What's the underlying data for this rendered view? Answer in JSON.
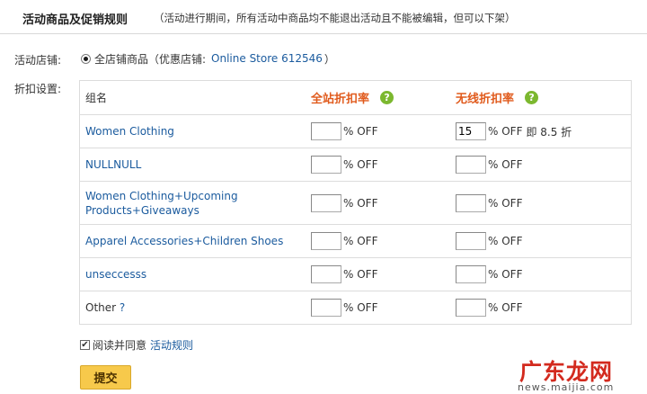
{
  "header": {
    "title": "活动商品及促销规则",
    "note": "（活动进行期间，所有活动中商品均不能退出活动且不能被编辑，但可以下架）"
  },
  "store": {
    "label": "活动店铺:",
    "option_text": "全店铺商品（优惠店铺:",
    "store_name": "Online Store 612546",
    "suffix": "）"
  },
  "discount": {
    "label": "折扣设置:",
    "columns": {
      "group": "组名",
      "site_rate": "全站折扣率",
      "mobile_rate": "无线折扣率",
      "help_glyph": "?"
    },
    "off_text": "% OFF",
    "rows": [
      {
        "name": "Women Clothing",
        "site_value": "",
        "mobile_value": "15",
        "mobile_extra": "即 8.5 折"
      },
      {
        "name": "NULLNULL",
        "site_value": "",
        "mobile_value": "",
        "mobile_extra": ""
      },
      {
        "name": "Women Clothing+Upcoming Products+Giveaways",
        "site_value": "",
        "mobile_value": "",
        "mobile_extra": ""
      },
      {
        "name": "Apparel Accessories+Children Shoes",
        "site_value": "",
        "mobile_value": "",
        "mobile_extra": ""
      },
      {
        "name": "unseccesss",
        "site_value": "",
        "mobile_value": "",
        "mobile_extra": ""
      },
      {
        "name": "Other",
        "name_link": "?",
        "site_value": "",
        "mobile_value": "",
        "mobile_extra": ""
      }
    ]
  },
  "agreement": {
    "checked": true,
    "text": "阅读并同意",
    "link": "活动规则"
  },
  "submit_label": "提交",
  "watermark": {
    "main": "广东龙网",
    "sub": "news.maijia.com"
  },
  "colors": {
    "link": "#1b5b9e",
    "rate_header": "#e05a1c",
    "help_badge": "#7cb82f",
    "submit_bg": "#f7c94b",
    "watermark": "#d32a1e"
  }
}
